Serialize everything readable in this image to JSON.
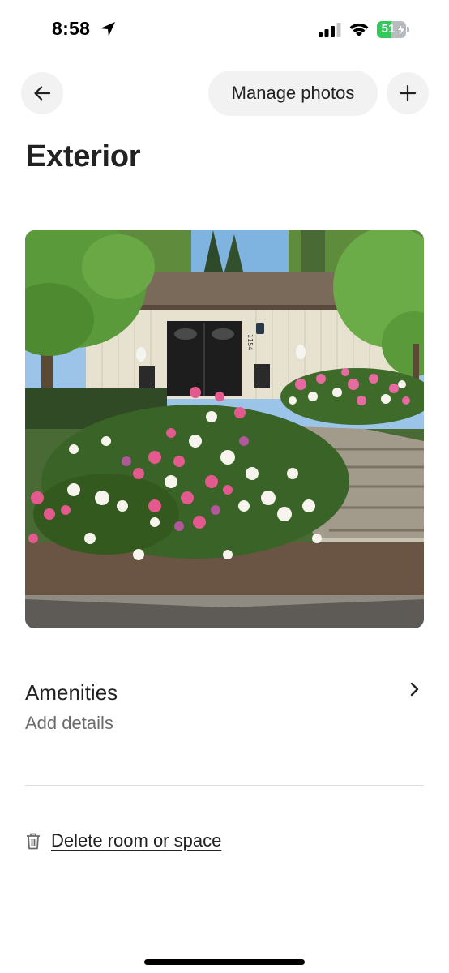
{
  "status_bar": {
    "time": "8:58",
    "battery_level": "51",
    "battery_fraction": 0.51,
    "battery_color": "#34c759",
    "icons": [
      "location-arrow-icon",
      "cellular-signal-icon",
      "wifi-icon",
      "battery-charging-icon"
    ]
  },
  "header": {
    "back_icon": "arrow-left-icon",
    "manage_photos_label": "Manage photos",
    "add_icon": "plus-icon"
  },
  "page": {
    "title": "Exterior"
  },
  "photo": {
    "house_number": "1154"
  },
  "amenities": {
    "title": "Amenities",
    "subtitle": "Add details",
    "chevron_icon": "chevron-right-icon"
  },
  "delete": {
    "icon": "trash-icon",
    "label": "Delete room or space"
  }
}
